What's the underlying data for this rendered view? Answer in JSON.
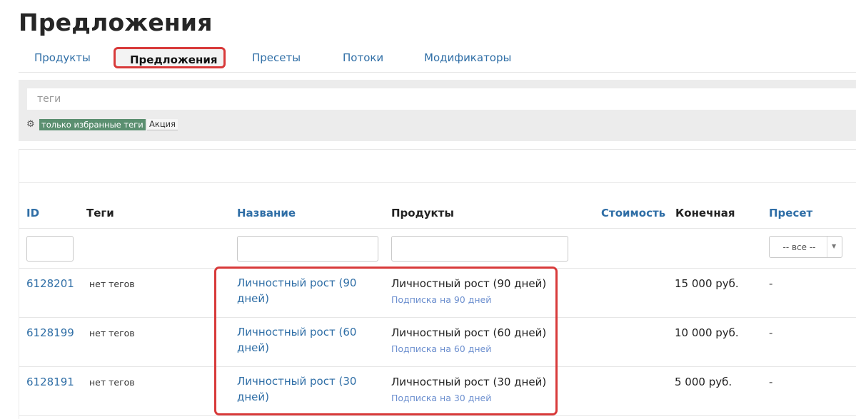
{
  "page": {
    "title": "Предложения"
  },
  "tabs": [
    {
      "label": "Продукты",
      "active": false
    },
    {
      "label": "Предложения",
      "active": true
    },
    {
      "label": "Пресеты",
      "active": false
    },
    {
      "label": "Потоки",
      "active": false
    },
    {
      "label": "Модификаторы",
      "active": false
    }
  ],
  "filters": {
    "tags_placeholder": "теги",
    "settings_icon": "gear-icon",
    "favorite_tags_label": "только избранные теги",
    "tag_chip": "Акция"
  },
  "table": {
    "columns": {
      "id": "ID",
      "tags": "Теги",
      "name": "Название",
      "products": "Продукты",
      "cost": "Стоимость",
      "final": "Конечная",
      "preset": "Пресет"
    },
    "preset_filter": {
      "selected": "-- все --"
    },
    "rows": [
      {
        "id": "6128201",
        "tags": "нет тегов",
        "name": "Личностный рост (90 дней)",
        "product": "Личностный рост (90 дней)",
        "product_sub": "Подписка на 90 дней",
        "final": "15 000 руб.",
        "preset": "-"
      },
      {
        "id": "6128199",
        "tags": "нет тегов",
        "name": "Личностный рост (60 дней)",
        "product": "Личностный рост (60 дней)",
        "product_sub": "Подписка на 60 дней",
        "final": "10 000 руб.",
        "preset": "-"
      },
      {
        "id": "6128191",
        "tags": "нет тегов",
        "name": "Личностный рост (30 дней)",
        "product": "Личностный рост (30 дней)",
        "product_sub": "Подписка на 30 дней",
        "final": "5 000 руб.",
        "preset": "-"
      }
    ]
  },
  "colors": {
    "link": "#2f6ea6",
    "highlight": "#d83a3a",
    "favorite_tag_bg": "#5b8f70",
    "panel_bg": "#ececec"
  }
}
